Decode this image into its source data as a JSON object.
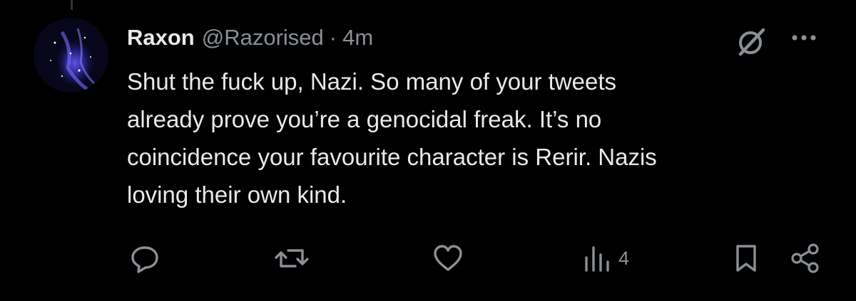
{
  "tweet": {
    "author": {
      "display_name": "Raxon",
      "handle": "@Razorised"
    },
    "separator": "·",
    "timestamp": "4m",
    "text": "Shut the fuck up, Nazi. So many of your tweets\nalready prove you’re a genocidal freak. It’s no\ncoincidence your favourite character is Rerir. Nazis\nloving their own kind.",
    "metrics": {
      "views": "4"
    }
  },
  "icons": {
    "top_right": [
      "grok-icon",
      "more-icon"
    ],
    "actions": [
      "reply-icon",
      "retweet-icon",
      "like-icon",
      "views-icon",
      "bookmark-icon",
      "share-icon"
    ]
  },
  "colors": {
    "background": "#000000",
    "text_primary": "#e7e9ea",
    "text_secondary": "#8b9096",
    "icon": "#8b9096"
  }
}
